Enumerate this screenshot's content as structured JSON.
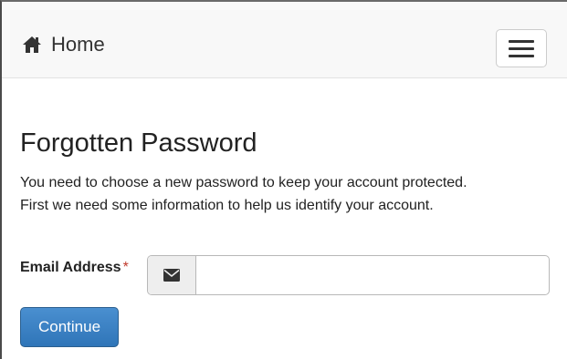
{
  "navbar": {
    "brand_label": "Home",
    "brand_icon": "home-icon",
    "menu_icon": "hamburger-menu-icon"
  },
  "main": {
    "title": "Forgotten Password",
    "description_line1": "You need to choose a new password to keep your account protected.",
    "description_line2": "First we need some information to help us identify your account."
  },
  "form": {
    "email_label": "Email Address",
    "required_marker": "*",
    "email_icon": "envelope-icon",
    "email_value": "",
    "email_placeholder": "",
    "submit_label": "Continue"
  },
  "colors": {
    "primary_button": "#337ab7",
    "required": "#c0392b",
    "navbar_bg": "#f8f8f8"
  }
}
